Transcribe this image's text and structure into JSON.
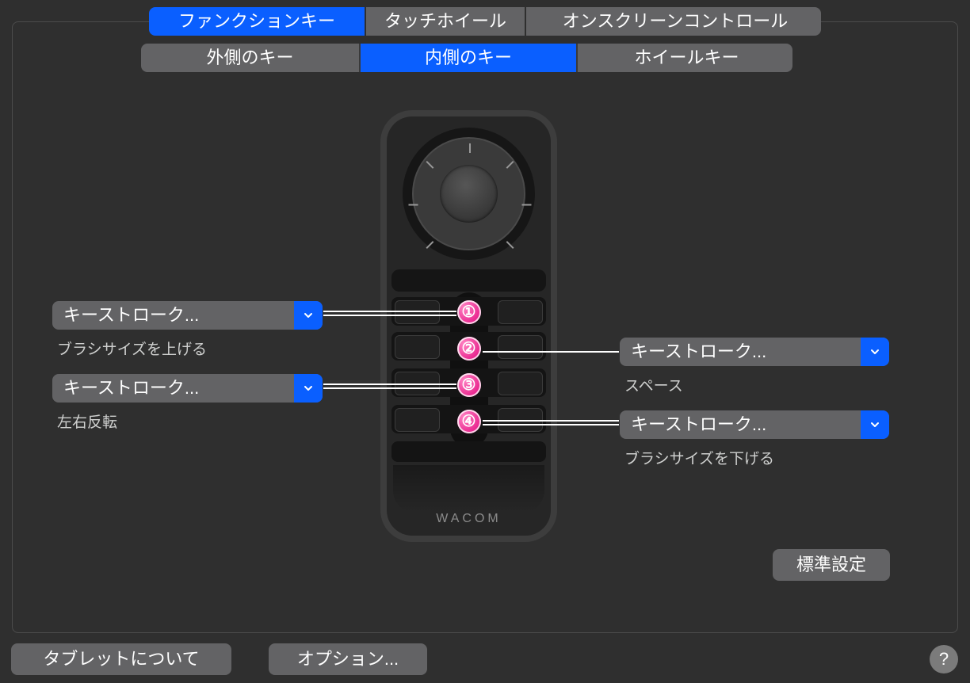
{
  "tabs_main": {
    "function": "ファンクションキー",
    "touchwheel": "タッチホイール",
    "onscreen": "オンスクリーンコントロール"
  },
  "tabs_sub": {
    "outer": "外側のキー",
    "inner": "内側のキー",
    "wheel": "ホイールキー"
  },
  "left": {
    "dd1": {
      "label": "キーストローク...",
      "sub": "ブラシサイズを上げる"
    },
    "dd3": {
      "label": "キーストローク...",
      "sub": "左右反転"
    }
  },
  "right": {
    "dd2": {
      "label": "キーストローク...",
      "sub": "スペース"
    },
    "dd4": {
      "label": "キーストローク...",
      "sub": "ブラシサイズを下げる"
    }
  },
  "buttons": {
    "default": "標準設定",
    "about": "タブレットについて",
    "options": "オプション..."
  },
  "device": {
    "brand": "WACOM",
    "numbers": [
      "①",
      "②",
      "③",
      "④"
    ]
  },
  "help": "?"
}
